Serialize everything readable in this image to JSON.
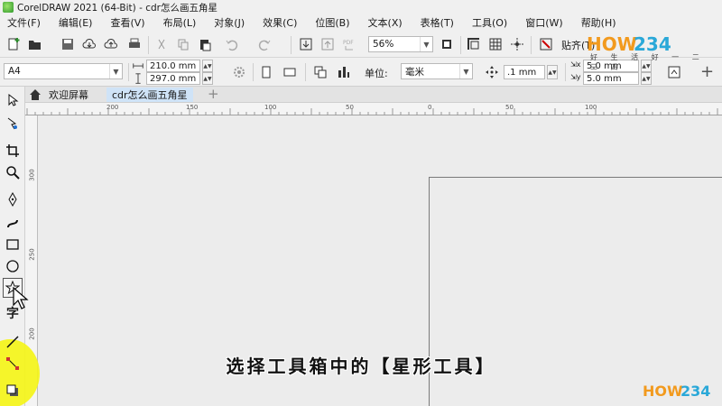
{
  "window": {
    "title": "CorelDRAW 2021 (64-Bit) - cdr怎么画五角星"
  },
  "menu": [
    "文件(F)",
    "编辑(E)",
    "查看(V)",
    "布局(L)",
    "对象(J)",
    "效果(C)",
    "位图(B)",
    "文本(X)",
    "表格(T)",
    "工具(O)",
    "窗口(W)",
    "帮助(H)"
  ],
  "toolbar": {
    "zoom": "56%",
    "snap_label": "贴齐(T)"
  },
  "property_bar": {
    "page_size": "A4",
    "width": "210.0 mm",
    "height": "297.0 mm",
    "units_label": "单位:",
    "units_value": "毫米",
    "nudge": ".1 mm",
    "dup_x": "5.0 mm",
    "dup_y": "5.0 mm"
  },
  "tabs": [
    "欢迎屏幕",
    "cdr怎么画五角星"
  ],
  "ruler": {
    "h_labels": [
      "200",
      "150",
      "100",
      "50",
      "0",
      "50",
      "100"
    ],
    "v_labels": [
      "300",
      "250",
      "200"
    ]
  },
  "caption": "选择工具箱中的【星形工具】",
  "watermark": {
    "brand": "HOW234",
    "sub": "好 生 活 好 一 二 三 四"
  },
  "colors": {
    "highlight": "#f5f514",
    "accent_tab": "#cfe3f7"
  },
  "icons": {
    "toolbox": [
      "pick-icon",
      "shape-icon",
      "crop-icon",
      "zoom-icon",
      "pen-icon",
      "artistic-media-icon",
      "rectangle-icon",
      "ellipse-icon",
      "star-icon",
      "text-icon",
      "line-icon",
      "connector-icon",
      "shadow-icon"
    ]
  }
}
